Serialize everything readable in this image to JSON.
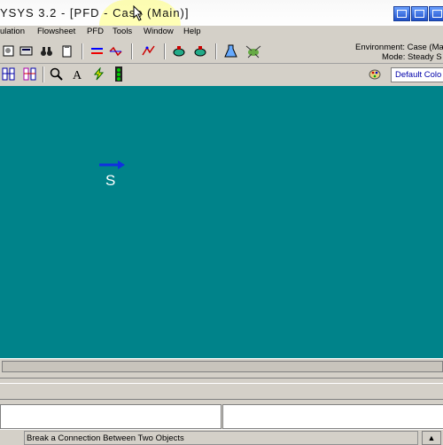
{
  "window": {
    "title": "YSYS 3.2 - [PFD - Case (Main)]"
  },
  "menu": {
    "items": [
      {
        "label": "ulation"
      },
      {
        "label": "Flowsheet"
      },
      {
        "label": "PFD"
      },
      {
        "label": "Tools"
      },
      {
        "label": "Window"
      },
      {
        "label": "Help"
      }
    ]
  },
  "environment": {
    "line1": "Environment: Case (Ma",
    "line2": "Mode: Steady S"
  },
  "color_scheme": {
    "selected": "Default Colo"
  },
  "pfd": {
    "background_color": "#00838a",
    "stream": {
      "name": "S",
      "arrow_color": "#1030e0"
    }
  },
  "status": {
    "message": "Break a Connection Between Two Objects"
  },
  "icons": [
    "workbook-icon",
    "binoculars-icon",
    "clipboard-icon",
    "material-stream-icon",
    "energy-stream-icon",
    "heat-exchanger-icon",
    "valve-icon",
    "mixer-icon",
    "flask-icon",
    "ant-icon",
    "zoom-icon",
    "text-icon",
    "lightning-icon",
    "palette-icon"
  ]
}
